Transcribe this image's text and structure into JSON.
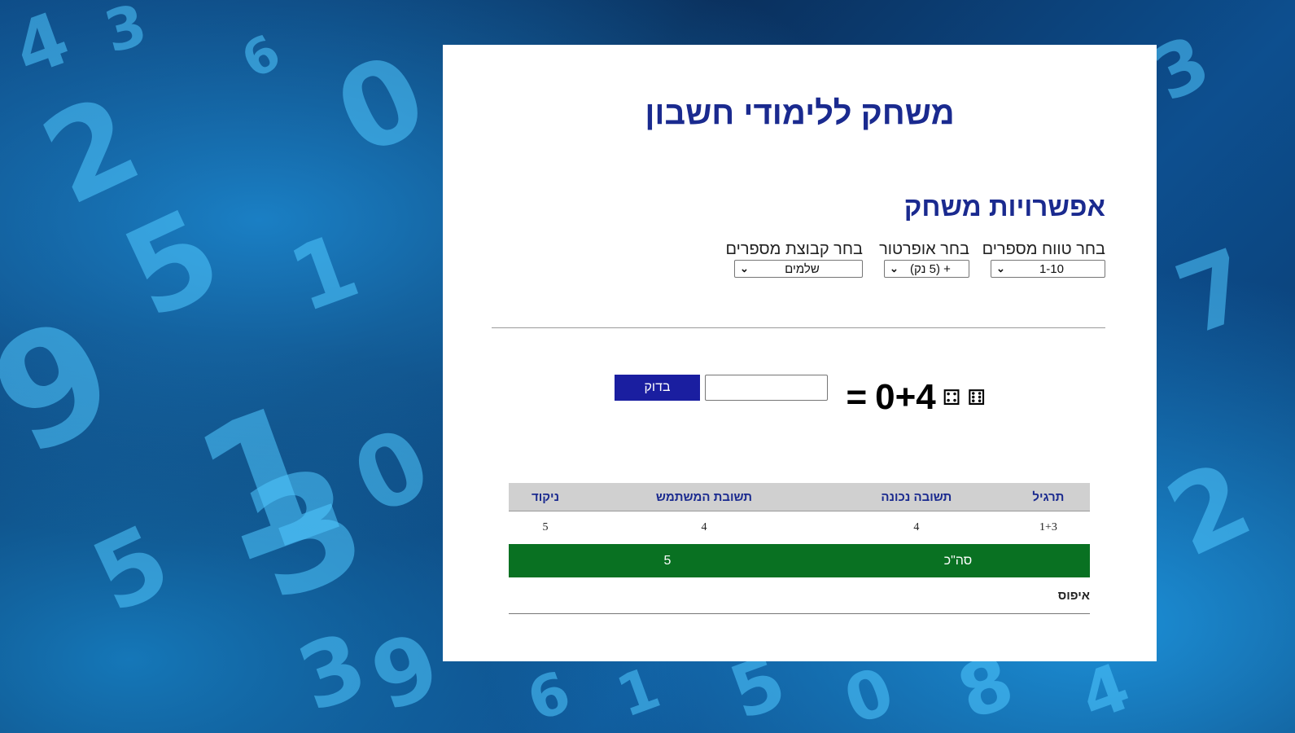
{
  "title": "משחק ללימודי חשבון",
  "options": {
    "heading": "אפשרויות משחק",
    "range": {
      "label": "בחר טווח מספרים",
      "value": "1-10"
    },
    "operator": {
      "label": "בחר אופרטור",
      "value": "+ (5 נק)"
    },
    "set": {
      "label": "בחר קבוצת מספרים",
      "value": "שלמים"
    }
  },
  "question": {
    "dice1": "⚃",
    "dice2": "⚅",
    "expression": "0+4",
    "equals": "="
  },
  "check_button": "בדוק",
  "table": {
    "headers": [
      "תרגיל",
      "תשובה נכונה",
      "תשובת המשתמש",
      "ניקוד"
    ],
    "rows": [
      {
        "exercise": "1+3",
        "correct": "4",
        "user": "4",
        "score": "5"
      }
    ],
    "total_label": "סה\"כ",
    "total_value": "5",
    "reset": "איפוס"
  }
}
